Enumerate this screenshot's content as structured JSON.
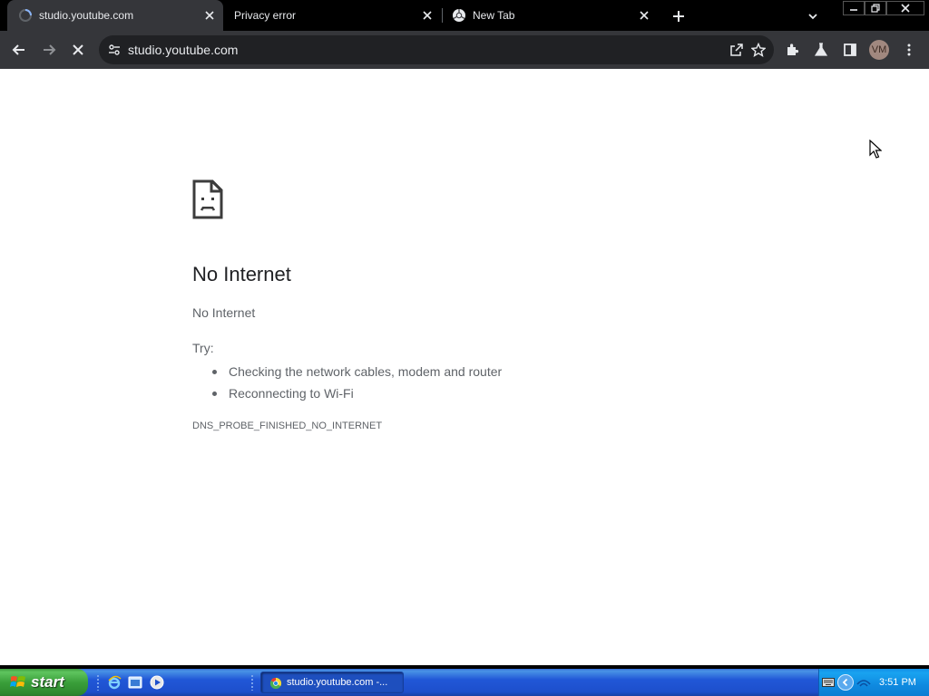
{
  "browser": {
    "tabs": [
      {
        "title": "studio.youtube.com",
        "active": true,
        "icon": "loading-spinner-icon"
      },
      {
        "title": "Privacy error",
        "active": false,
        "icon": "none"
      },
      {
        "title": "New Tab",
        "active": false,
        "icon": "chrome-icon"
      }
    ],
    "omnibox": {
      "url": "studio.youtube.com"
    },
    "profile_initials": "VM",
    "theme": {
      "tabstrip": "#000000",
      "toolbar": "#35363a",
      "omnibox": "#202124",
      "text": "#e8eaed",
      "avatar_bg": "#a1887f"
    }
  },
  "error_page": {
    "icon": "sad-document-icon",
    "title": "No Internet",
    "subtitle": "No Internet",
    "try_label": "Try:",
    "suggestions": [
      "Checking the network cables, modem and router",
      "Reconnecting to Wi-Fi"
    ],
    "error_code": "DNS_PROBE_FINISHED_NO_INTERNET"
  },
  "taskbar": {
    "start_label": "start",
    "quick_launch": [
      "ie-icon",
      "windows-explorer-icon",
      "media-player-icon"
    ],
    "task_button_label": "studio.youtube.com -...",
    "clock": "3:51 PM",
    "tray_icons": [
      "keyboard-icon",
      "show-hidden-icons-icon",
      "network-icon"
    ]
  }
}
